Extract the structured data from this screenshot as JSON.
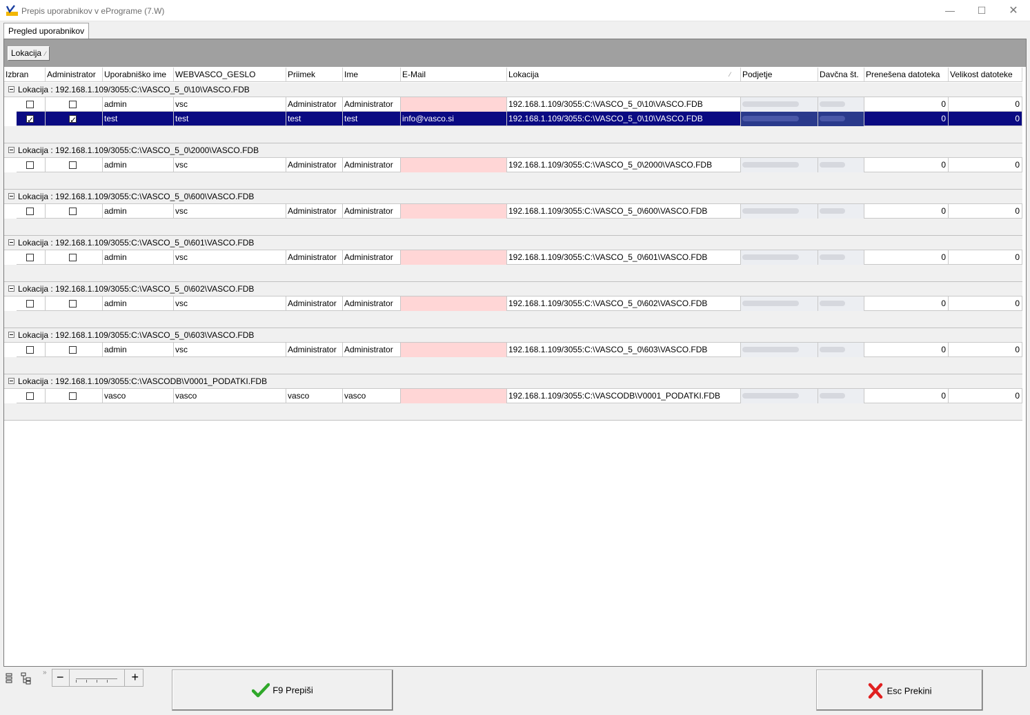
{
  "window": {
    "title": "Prepis uporabnikov v ePrograme  (7.W)",
    "minimize": "—",
    "maximize": "☐",
    "close": "✕"
  },
  "tabs": [
    "Pregled uporabnikov"
  ],
  "grouping": {
    "chip_label": "Lokacija",
    "sort_glyph": "⁄"
  },
  "columns": [
    "Izbran",
    "Administrator",
    "Uporabniško ime",
    "WEBVASCO_GESLO",
    "Priimek",
    "Ime",
    "E-Mail",
    "Lokacija",
    "Podjetje",
    "Davčna št.",
    "Prenešena datoteka",
    "Velikost datoteke"
  ],
  "sort_glyph_lokacija": "⁄",
  "groups": [
    {
      "label": "Lokacija : 192.168.1.109/3055:C:\\VASCO_5_0\\10\\VASCO.FDB",
      "rows": [
        {
          "izbran": false,
          "admin": false,
          "user": "admin",
          "geslo": "vsc",
          "priimek": "Administrator",
          "ime": "Administrator",
          "email": "",
          "lokacija": "192.168.1.109/3055:C:\\VASCO_5_0\\10\\VASCO.FDB",
          "prenesena": "0",
          "velikost": "0",
          "selected": false
        },
        {
          "izbran": true,
          "admin": true,
          "user": "test",
          "geslo": "test",
          "priimek": "test",
          "ime": "test",
          "email": "info@vasco.si",
          "lokacija": "192.168.1.109/3055:C:\\VASCO_5_0\\10\\VASCO.FDB",
          "prenesena": "0",
          "velikost": "0",
          "selected": true
        }
      ]
    },
    {
      "label": "Lokacija : 192.168.1.109/3055:C:\\VASCO_5_0\\2000\\VASCO.FDB",
      "rows": [
        {
          "izbran": false,
          "admin": false,
          "user": "admin",
          "geslo": "vsc",
          "priimek": "Administrator",
          "ime": "Administrator",
          "email": "",
          "lokacija": "192.168.1.109/3055:C:\\VASCO_5_0\\2000\\VASCO.FDB",
          "prenesena": "0",
          "velikost": "0",
          "selected": false
        }
      ]
    },
    {
      "label": "Lokacija : 192.168.1.109/3055:C:\\VASCO_5_0\\600\\VASCO.FDB",
      "rows": [
        {
          "izbran": false,
          "admin": false,
          "user": "admin",
          "geslo": "vsc",
          "priimek": "Administrator",
          "ime": "Administrator",
          "email": "",
          "lokacija": "192.168.1.109/3055:C:\\VASCO_5_0\\600\\VASCO.FDB",
          "prenesena": "0",
          "velikost": "0",
          "selected": false
        }
      ]
    },
    {
      "label": "Lokacija : 192.168.1.109/3055:C:\\VASCO_5_0\\601\\VASCO.FDB",
      "rows": [
        {
          "izbran": false,
          "admin": false,
          "user": "admin",
          "geslo": "vsc",
          "priimek": "Administrator",
          "ime": "Administrator",
          "email": "",
          "lokacija": "192.168.1.109/3055:C:\\VASCO_5_0\\601\\VASCO.FDB",
          "prenesena": "0",
          "velikost": "0",
          "selected": false
        }
      ]
    },
    {
      "label": "Lokacija : 192.168.1.109/3055:C:\\VASCO_5_0\\602\\VASCO.FDB",
      "rows": [
        {
          "izbran": false,
          "admin": false,
          "user": "admin",
          "geslo": "vsc",
          "priimek": "Administrator",
          "ime": "Administrator",
          "email": "",
          "lokacija": "192.168.1.109/3055:C:\\VASCO_5_0\\602\\VASCO.FDB",
          "prenesena": "0",
          "velikost": "0",
          "selected": false
        }
      ]
    },
    {
      "label": "Lokacija : 192.168.1.109/3055:C:\\VASCO_5_0\\603\\VASCO.FDB",
      "rows": [
        {
          "izbran": false,
          "admin": false,
          "user": "admin",
          "geslo": "vsc",
          "priimek": "Administrator",
          "ime": "Administrator",
          "email": "",
          "lokacija": "192.168.1.109/3055:C:\\VASCO_5_0\\603\\VASCO.FDB",
          "prenesena": "0",
          "velikost": "0",
          "selected": false
        }
      ]
    },
    {
      "label": "Lokacija : 192.168.1.109/3055:C:\\VASCODB\\V0001_PODATKI.FDB",
      "rows": [
        {
          "izbran": false,
          "admin": false,
          "user": "vasco",
          "geslo": "vasco",
          "priimek": "vasco",
          "ime": "vasco",
          "email": "",
          "lokacija": "192.168.1.109/3055:C:\\VASCODB\\V0001_PODATKI.FDB",
          "prenesena": "0",
          "velikost": "0",
          "selected": false
        }
      ]
    }
  ],
  "toolbar": {
    "zoom_minus": "−",
    "zoom_plus": "+",
    "expand_glyph": "»"
  },
  "buttons": {
    "save_label": "F9 Prepiši",
    "cancel_label": "Esc Prekini"
  },
  "colors": {
    "selection": "#0a0a82",
    "email_empty": "#ffd6d6",
    "group_bar": "#a0a0a0"
  }
}
